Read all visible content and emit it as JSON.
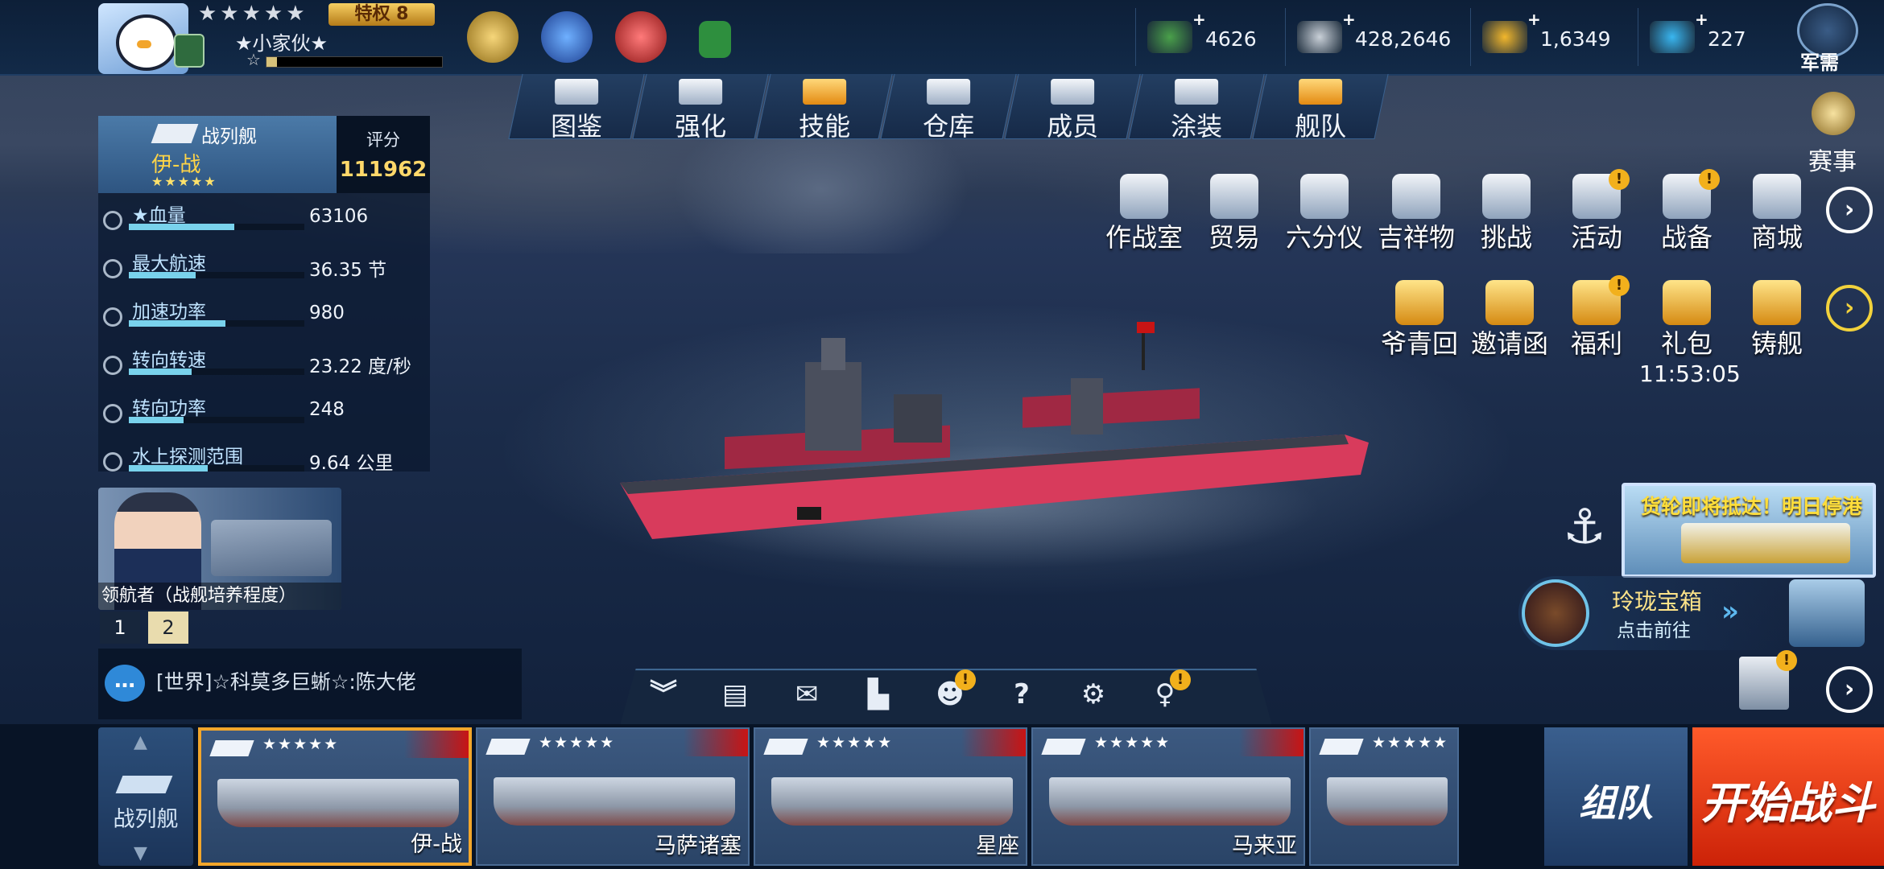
{
  "player": {
    "stars": "★★★★★",
    "privilege": "特权 8",
    "name": "★小家伙★",
    "exp_star": "☆",
    "exp_progress": 0.06
  },
  "resources": [
    {
      "icon": "cash-icon",
      "plus": "+",
      "value": "4626",
      "color": "#4aa04a"
    },
    {
      "icon": "silver-coins-icon",
      "plus": "+",
      "value": "428,2646",
      "color": "#c9d0d8"
    },
    {
      "icon": "gold-coins-icon",
      "plus": "+",
      "value": "1,6349",
      "color": "#f2b72c"
    },
    {
      "icon": "diamond-icon",
      "plus": "+",
      "value": "227",
      "color": "#39b6f0"
    }
  ],
  "supply": {
    "label": "军需"
  },
  "tabs": [
    {
      "label": "图鉴",
      "icon": "book-icon"
    },
    {
      "label": "强化",
      "icon": "upgrade-icon"
    },
    {
      "label": "技能",
      "icon": "skill-icon"
    },
    {
      "label": "仓库",
      "icon": "warehouse-icon"
    },
    {
      "label": "成员",
      "icon": "crew-icon"
    },
    {
      "label": "涂装",
      "icon": "paint-icon"
    },
    {
      "label": "舰队",
      "icon": "fleet-icon"
    }
  ],
  "ship": {
    "class": "战列舰",
    "name": "伊-战",
    "stars": "★★★★★",
    "rating_label": "评分",
    "rating": "111962",
    "stats": [
      {
        "label": "★血量",
        "value": "63106",
        "fill": 0.6
      },
      {
        "label": "最大航速",
        "value": "36.35 节",
        "fill": 0.38
      },
      {
        "label": "加速功率",
        "value": "980",
        "fill": 0.55
      },
      {
        "label": "转向转速",
        "value": "23.22 度/秒",
        "fill": 0.36
      },
      {
        "label": "转向功率",
        "value": "248",
        "fill": 0.31
      },
      {
        "label": "水上探测范围",
        "value": "9.64 公里",
        "fill": 0.45
      }
    ]
  },
  "captain": {
    "label": "领航者（战舰培养程度）"
  },
  "pages": [
    "1",
    "2"
  ],
  "chat": {
    "text": "[世界]☆科莫多巨蜥☆:陈大佬"
  },
  "events": {
    "label": "赛事"
  },
  "features_row1": [
    {
      "label": "作战室",
      "icon": "war-room-icon",
      "alert": false
    },
    {
      "label": "贸易",
      "icon": "scales-icon",
      "alert": false
    },
    {
      "label": "六分仪",
      "icon": "sextant-icon",
      "alert": false
    },
    {
      "label": "吉祥物",
      "icon": "mascot-icon",
      "alert": false
    },
    {
      "label": "挑战",
      "icon": "challenge-icon",
      "alert": false
    },
    {
      "label": "活动",
      "icon": "megaphone-icon",
      "alert": true
    },
    {
      "label": "战备",
      "icon": "book-stack-icon",
      "alert": true
    },
    {
      "label": "商城",
      "icon": "cart-icon",
      "alert": false
    }
  ],
  "features_row2": [
    {
      "label": "爷青回",
      "icon": "gamepad-icon",
      "alert": false
    },
    {
      "label": "邀请函",
      "icon": "envelope-icon",
      "alert": false
    },
    {
      "label": "福利",
      "icon": "treasure-icon",
      "alert": true
    },
    {
      "label": "礼包",
      "icon": "gift-icon",
      "alert": false
    },
    {
      "label": "铸舰",
      "icon": "ingot-icon",
      "alert": false
    }
  ],
  "gift_timer": "11:53:05",
  "cargo_event": {
    "text": "货轮即将抵达！明日停港"
  },
  "chest": {
    "title": "玲珑宝箱",
    "subtitle": "点击前往"
  },
  "alert_mark": "!",
  "bottom_menu": [
    {
      "icon": "collapse-icon",
      "glyph": "︾",
      "alert": false
    },
    {
      "icon": "clipboard-icon",
      "glyph": "▤",
      "alert": false
    },
    {
      "icon": "mail-icon",
      "glyph": "✉",
      "alert": false
    },
    {
      "icon": "ranking-icon",
      "glyph": "▙",
      "alert": false
    },
    {
      "icon": "friends-icon",
      "glyph": "☻",
      "alert": true
    },
    {
      "icon": "help-icon",
      "glyph": "?",
      "alert": false
    },
    {
      "icon": "settings-icon",
      "glyph": "⚙",
      "alert": false
    },
    {
      "icon": "tips-icon",
      "glyph": "♀",
      "alert": true
    }
  ],
  "class_selector": {
    "label": "战列舰"
  },
  "ship_cards": [
    {
      "name": "伊-战",
      "stars": "★★★★★",
      "selected": true
    },
    {
      "name": "马萨诸塞",
      "stars": "★★★★★",
      "selected": false
    },
    {
      "name": "星座",
      "stars": "★★★★★",
      "selected": false
    },
    {
      "name": "马来亚",
      "stars": "★★★★★",
      "selected": false
    },
    {
      "name": "",
      "stars": "★★★★★",
      "selected": false
    }
  ],
  "buttons": {
    "team": "组队",
    "battle": "开始战斗"
  }
}
